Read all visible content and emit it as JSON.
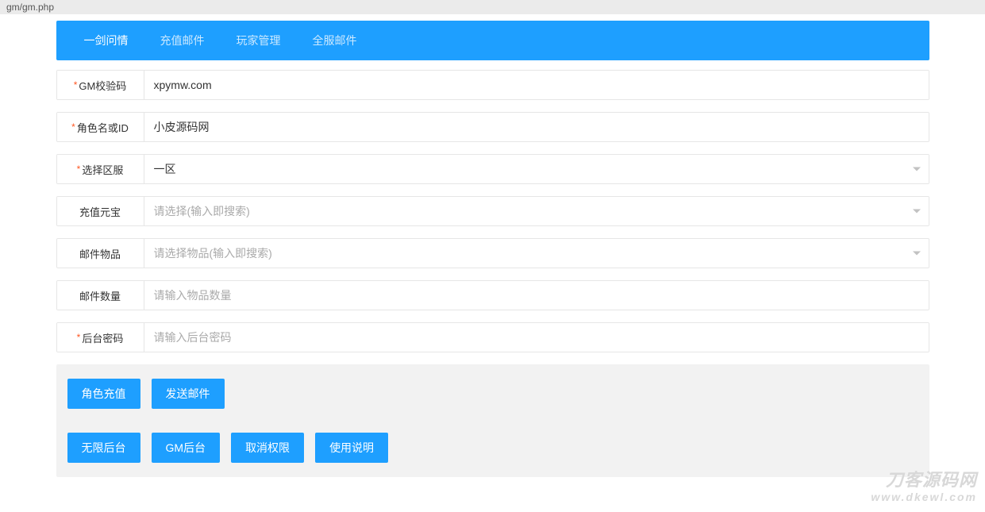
{
  "url_bar": "gm/gm.php",
  "tabs": [
    {
      "label": "一剑问情",
      "active": true
    },
    {
      "label": "充值邮件",
      "active": false
    },
    {
      "label": "玩家管理",
      "active": false
    },
    {
      "label": "全服邮件",
      "active": false
    }
  ],
  "fields": {
    "gm_code": {
      "label": "GM校验码",
      "required": true,
      "value": "xpymw.com",
      "placeholder": ""
    },
    "role_id": {
      "label": "角色名或ID",
      "required": true,
      "value": "小皮源码网",
      "placeholder": ""
    },
    "server": {
      "label": "选择区服",
      "required": true,
      "value": "一区",
      "placeholder": "",
      "type": "select"
    },
    "recharge": {
      "label": "充值元宝",
      "required": false,
      "value": "",
      "placeholder": "请选择(输入即搜索)",
      "type": "select"
    },
    "mail_item": {
      "label": "邮件物品",
      "required": false,
      "value": "",
      "placeholder": "请选择物品(输入即搜索)",
      "type": "select"
    },
    "mail_qty": {
      "label": "邮件数量",
      "required": false,
      "value": "",
      "placeholder": "请输入物品数量"
    },
    "admin_pw": {
      "label": "后台密码",
      "required": true,
      "value": "",
      "placeholder": "请输入后台密码"
    }
  },
  "buttons": {
    "row1": [
      {
        "key": "role-recharge",
        "label": "角色充值"
      },
      {
        "key": "send-mail",
        "label": "发送邮件"
      }
    ],
    "row2": [
      {
        "key": "unlimited-backend",
        "label": "无限后台"
      },
      {
        "key": "gm-backend",
        "label": "GM后台"
      },
      {
        "key": "cancel-perm",
        "label": "取消权限"
      },
      {
        "key": "usage-guide",
        "label": "使用说明"
      }
    ]
  },
  "watermark": {
    "line1": "刀客源码网",
    "line2": "www.dkewl.com"
  }
}
